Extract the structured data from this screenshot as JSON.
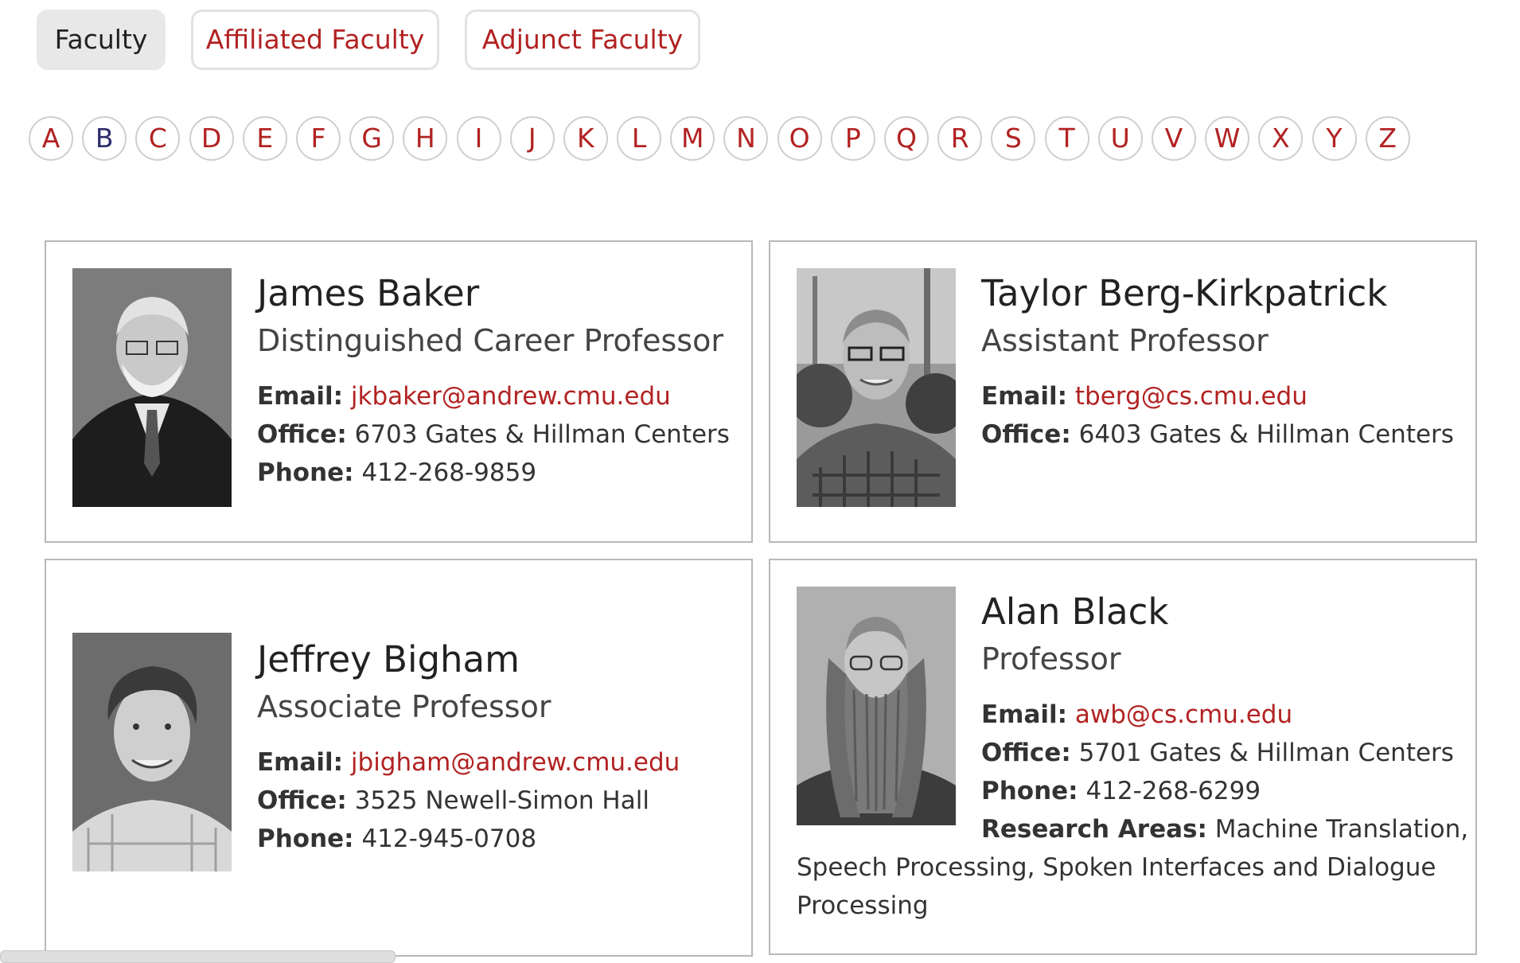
{
  "tabs": [
    {
      "label": "Faculty",
      "active": true
    },
    {
      "label": "Affiliated Faculty",
      "active": false
    },
    {
      "label": "Adjunct Faculty",
      "active": false
    }
  ],
  "letters": [
    "A",
    "B",
    "C",
    "D",
    "E",
    "F",
    "G",
    "H",
    "I",
    "J",
    "K",
    "L",
    "M",
    "N",
    "O",
    "P",
    "Q",
    "R",
    "S",
    "T",
    "U",
    "V",
    "W",
    "X",
    "Y",
    "Z"
  ],
  "current_letter": "B",
  "labels": {
    "email": "Email:",
    "office": "Office:",
    "phone": "Phone:",
    "research": "Research Areas:"
  },
  "faculty": [
    {
      "name": "James Baker",
      "title": "Distinguished Career Professor",
      "email": "jkbaker@andrew.cmu.edu",
      "office": "6703 Gates & Hillman Centers",
      "phone": "412-268-9859"
    },
    {
      "name": "Taylor Berg-Kirkpatrick",
      "title": "Assistant Professor",
      "email": "tberg@cs.cmu.edu",
      "office": "6403 Gates & Hillman Centers"
    },
    {
      "name": "Jeffrey Bigham",
      "title": "Associate Professor",
      "email": "jbigham@andrew.cmu.edu",
      "office": "3525 Newell-Simon Hall",
      "phone": "412-945-0708"
    },
    {
      "name": "Alan Black",
      "title": "Professor",
      "email": "awb@cs.cmu.edu",
      "office": "5701 Gates & Hillman Centers",
      "phone": "412-268-6299",
      "research_line1": "Machine Translation,",
      "research_rest": "Speech Processing, Spoken Interfaces and Dialogue Processing"
    }
  ],
  "colors": {
    "link": "#b22222",
    "current_letter": "#2d2d6b",
    "active_tab_bg": "#e8e8e8"
  }
}
